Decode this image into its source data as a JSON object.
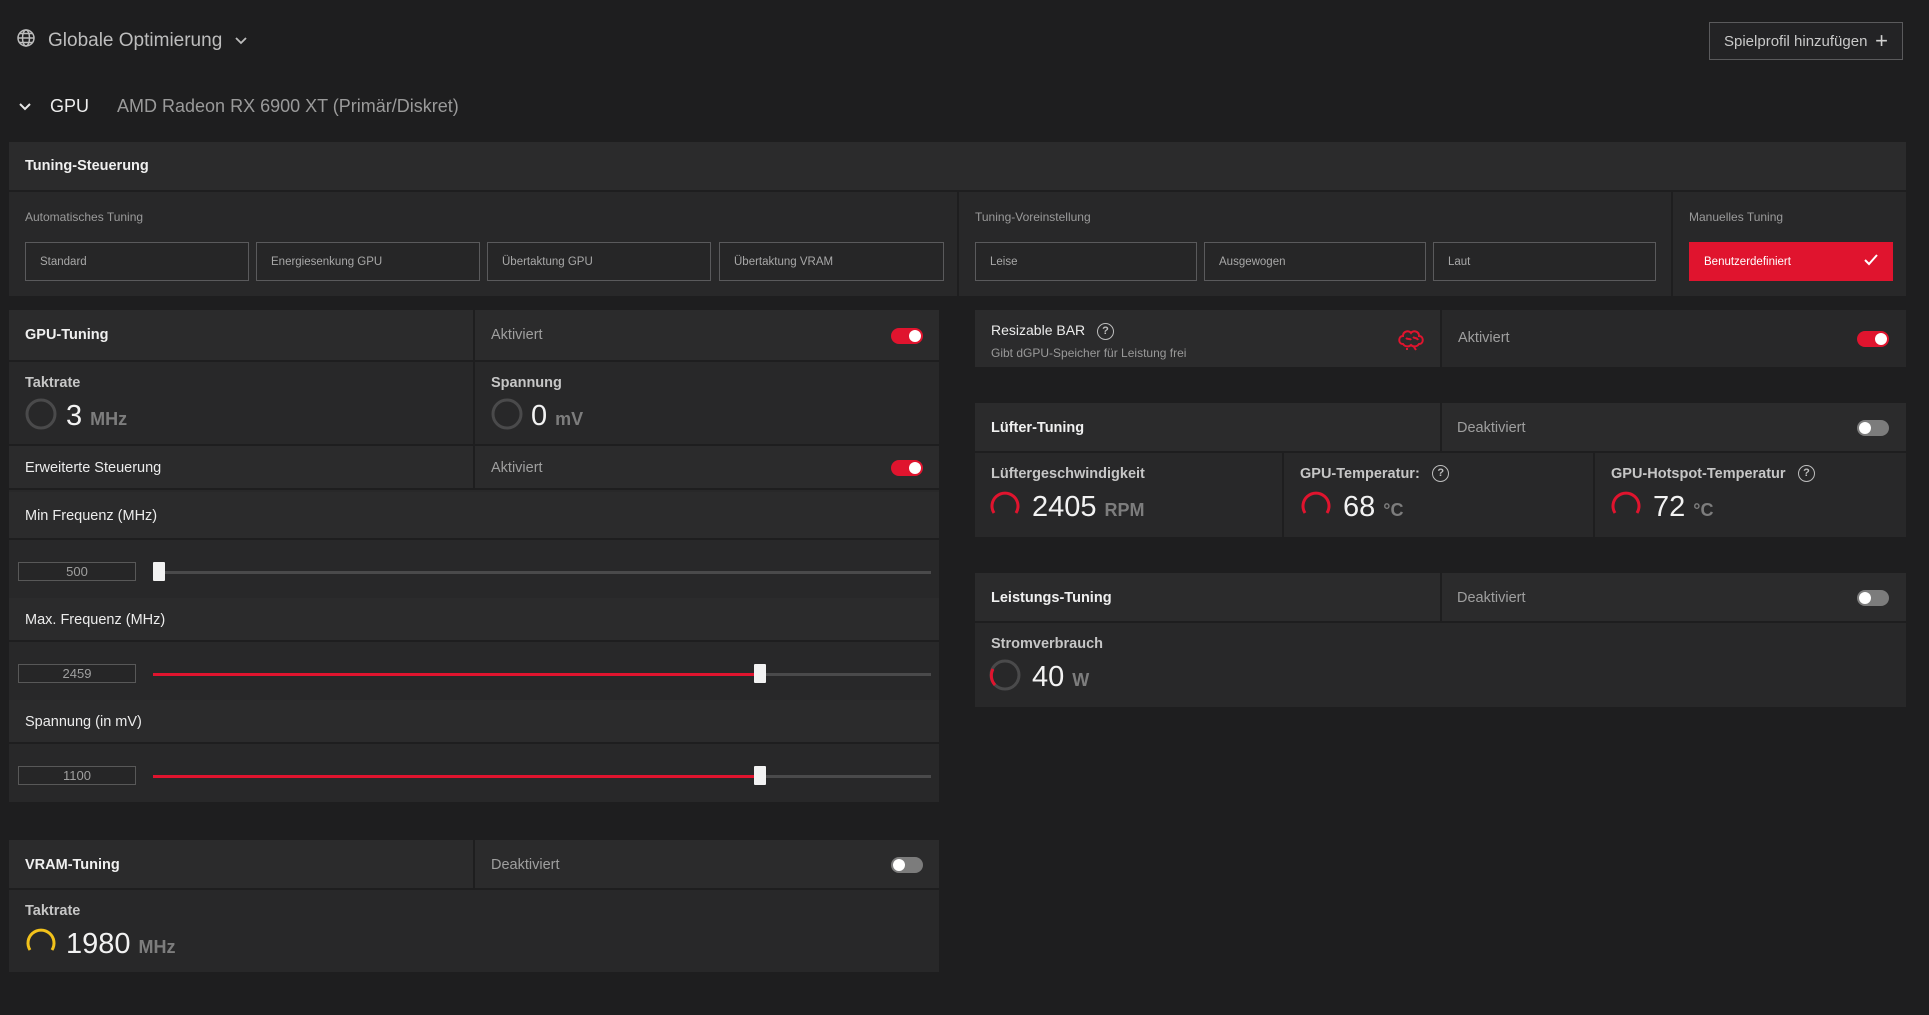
{
  "topbar": {
    "scope_label": "Globale Optimierung",
    "add_profile_label": "Spielprofil hinzufügen"
  },
  "gpu": {
    "label": "GPU",
    "name": "AMD Radeon RX 6900 XT (Primär/Diskret)"
  },
  "tuning_control": {
    "title": "Tuning-Steuerung",
    "auto": {
      "label": "Automatisches Tuning",
      "options": [
        "Standard",
        "Energiesenkung GPU",
        "Übertaktung GPU",
        "Übertaktung VRAM"
      ]
    },
    "preset": {
      "label": "Tuning-Voreinstellung",
      "options": [
        "Leise",
        "Ausgewogen",
        "Laut"
      ]
    },
    "manual": {
      "label": "Manuelles Tuning",
      "option": "Benutzerdefiniert"
    }
  },
  "gpu_tuning": {
    "title": "GPU-Tuning",
    "status": "Aktiviert",
    "enabled": true,
    "clock": {
      "label": "Taktrate",
      "value": "3",
      "unit": "MHz"
    },
    "voltage": {
      "label": "Spannung",
      "value": "0",
      "unit": "mV"
    },
    "advanced": {
      "label": "Erweiterte Steuerung",
      "status": "Aktiviert",
      "enabled": true
    },
    "sliders": [
      {
        "label": "Min Frequenz (MHz)",
        "value": "500",
        "fraction": 0.0
      },
      {
        "label": "Max. Frequenz (MHz)",
        "value": "2459",
        "fraction": 0.78
      },
      {
        "label": "Spannung (in mV)",
        "value": "1100",
        "fraction": 0.78
      }
    ]
  },
  "vram_tuning": {
    "title": "VRAM-Tuning",
    "status": "Deaktiviert",
    "enabled": false,
    "clock": {
      "label": "Taktrate",
      "value": "1980",
      "unit": "MHz"
    }
  },
  "resizable_bar": {
    "title": "Resizable BAR",
    "description": "Gibt dGPU-Speicher für Leistung frei",
    "status": "Aktiviert",
    "enabled": true
  },
  "fan_tuning": {
    "title": "Lüfter-Tuning",
    "status": "Deaktiviert",
    "enabled": false,
    "metrics": [
      {
        "label": "Lüftergeschwindigkeit",
        "value": "2405",
        "unit": "RPM"
      },
      {
        "label": "GPU-Temperatur:",
        "value": "68",
        "unit": "°C"
      },
      {
        "label": "GPU-Hotspot-Temperatur",
        "value": "72",
        "unit": "°C"
      }
    ]
  },
  "power_tuning": {
    "title": "Leistungs-Tuning",
    "status": "Deaktiviert",
    "enabled": false,
    "power": {
      "label": "Stromverbrauch",
      "value": "40",
      "unit": "W"
    }
  },
  "colors": {
    "accent": "#e0142e",
    "vram_gauge": "#f2c21b",
    "background": "#1e1e1f",
    "panel": "#282829"
  },
  "icons": {
    "scope": "globe-icon",
    "scope_dropdown": "chevron-down-icon",
    "add": "plus-icon",
    "collapse": "chevron-down-icon",
    "check": "checkmark-icon",
    "help": "question-icon",
    "brain": "brain-icon"
  }
}
